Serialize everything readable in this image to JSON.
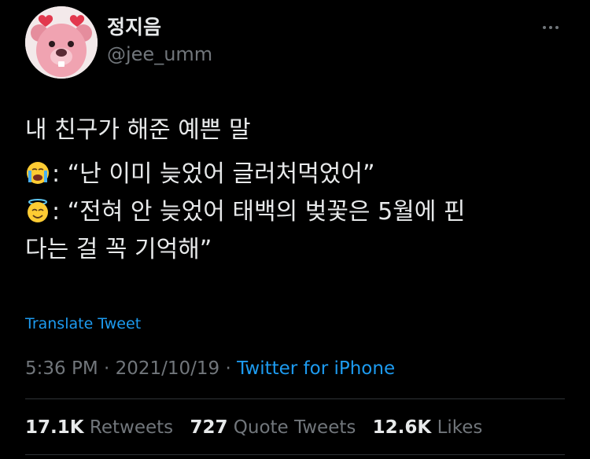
{
  "author": {
    "display_name": "정지음",
    "handle": "@jee_umm"
  },
  "tweet": {
    "line_1": "내 친구가 해준 예쁜 말",
    "line_2_speaker_icon": "loudly-crying-face-icon",
    "line_2_text": ": “난 이미 늦었어 글러처먹었어”",
    "line_3_speaker_icon": "smiling-face-with-halo-icon",
    "line_3_text": ": “전혀 안 늦었어 태백의 벚꽃은 5월에 핀",
    "line_4_text": "다는 걸 꼭 기억해”"
  },
  "translate_label": "Translate Tweet",
  "meta": {
    "time": "5:36 PM",
    "separator_1": " · ",
    "date": "2021/10/19",
    "separator_2": " · ",
    "source": "Twitter for iPhone"
  },
  "stats": {
    "retweets_count": "17.1K",
    "retweets_label": "Retweets",
    "quotes_count": "727",
    "quotes_label": "Quote Tweets",
    "likes_count": "12.6K",
    "likes_label": "Likes"
  },
  "colors": {
    "background": "#000000",
    "text_primary": "#e7e9ea",
    "text_secondary": "#71767b",
    "link": "#1d9bf0",
    "divider": "#2f3336"
  },
  "icons": {
    "more": "more-horizontal-icon",
    "avatar": "pink-beaver-avatar"
  }
}
